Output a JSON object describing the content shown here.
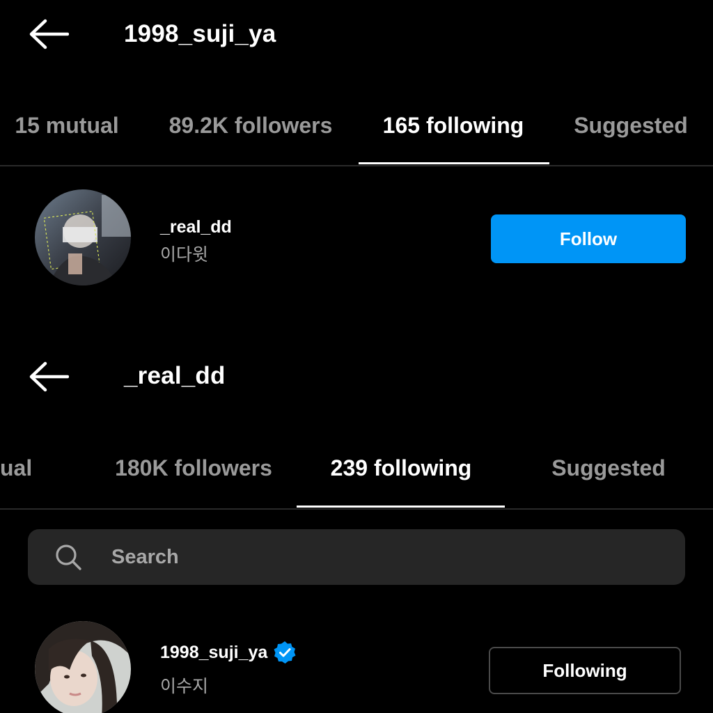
{
  "top_panel": {
    "header": {
      "title": "1998_suji_ya"
    },
    "tabs": [
      {
        "label": "15 mutual",
        "active": false
      },
      {
        "label": "89.2K followers",
        "active": false
      },
      {
        "label": "165 following",
        "active": true
      },
      {
        "label": "Suggested",
        "active": false
      }
    ],
    "user": {
      "username": "_real_dd",
      "full_name": "이다윗",
      "action_label": "Follow"
    }
  },
  "bottom_panel": {
    "header": {
      "title": "_real_dd"
    },
    "tabs": [
      {
        "label": "ual",
        "active": false
      },
      {
        "label": "180K followers",
        "active": false
      },
      {
        "label": "239 following",
        "active": true
      },
      {
        "label": "Suggested",
        "active": false
      }
    ],
    "search": {
      "placeholder": "Search"
    },
    "user": {
      "username": "1998_suji_ya",
      "full_name": "이수지",
      "verified": true,
      "action_label": "Following"
    }
  },
  "colors": {
    "background": "#000000",
    "accent_blue": "#0095f6",
    "muted_text": "#9a9a9a",
    "search_bg": "#262626"
  }
}
